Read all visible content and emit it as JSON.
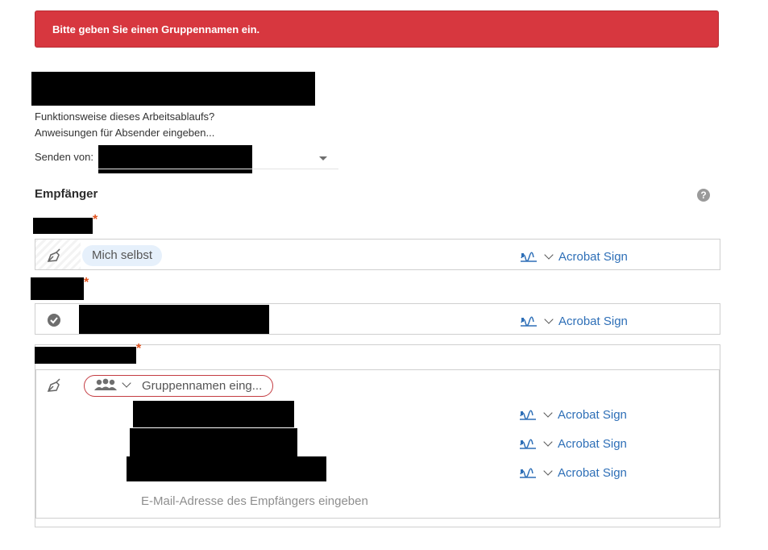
{
  "alert": {
    "message": "Bitte geben Sie einen Gruppennamen ein."
  },
  "workflow": {
    "how_it_works": "Funktionsweise dieses Arbeitsablaufs?",
    "instructions": "Anweisungen für Absender eingeben..."
  },
  "send_from": {
    "label": "Senden von:"
  },
  "recipients": {
    "title": "Empfänger",
    "help_icon": "question-circle-icon",
    "required_marker": "*",
    "rows": [
      {
        "chip": "Mich selbst",
        "signature": "Acrobat Sign"
      },
      {
        "signature": "Acrobat Sign"
      }
    ],
    "group": {
      "name_placeholder": "Gruppennamen eing...",
      "members": [
        {
          "signature": "Acrobat Sign"
        },
        {
          "signature": "Acrobat Sign"
        },
        {
          "signature": "Acrobat Sign"
        }
      ],
      "email_placeholder": "E-Mail-Adresse des Empfängers eingeben"
    }
  },
  "colors": {
    "alert": "#d7373f",
    "link": "#2e6fb7",
    "required": "#e2531f"
  }
}
